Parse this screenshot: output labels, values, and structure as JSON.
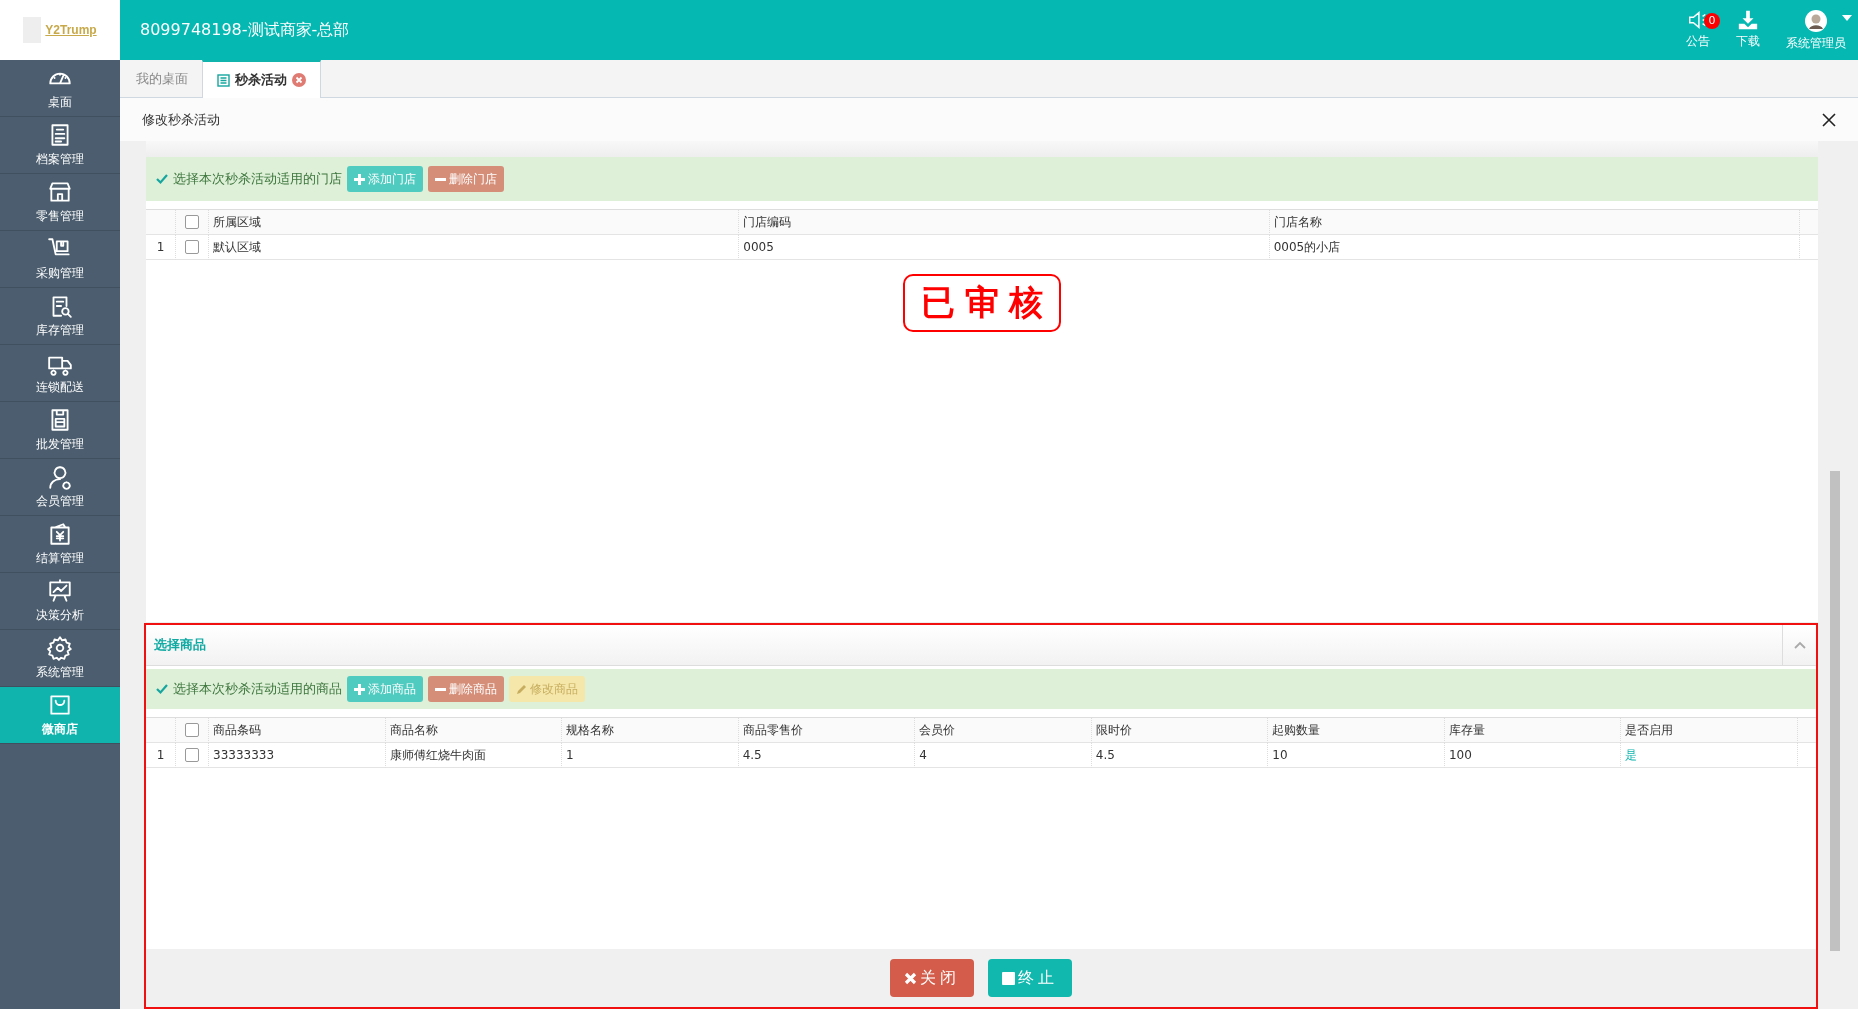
{
  "header": {
    "logo": "Y2Trump",
    "title": "8099748198-测试商家-总部",
    "actions": [
      {
        "label": "公告",
        "badge": "0"
      },
      {
        "label": "下载"
      },
      {
        "label": "系统管理员",
        "dropdown": true
      }
    ]
  },
  "sidebar": {
    "items": [
      {
        "label": "桌面",
        "selected": false
      },
      {
        "label": "档案管理",
        "selected": false
      },
      {
        "label": "零售管理",
        "selected": false
      },
      {
        "label": "采购管理",
        "selected": false
      },
      {
        "label": "库存管理",
        "selected": false
      },
      {
        "label": "连锁配送",
        "selected": false
      },
      {
        "label": "批发管理",
        "selected": false
      },
      {
        "label": "会员管理",
        "selected": false
      },
      {
        "label": "结算管理",
        "selected": false
      },
      {
        "label": "决策分析",
        "selected": false
      },
      {
        "label": "系统管理",
        "selected": false
      },
      {
        "label": "微商店",
        "selected": true
      }
    ]
  },
  "tabs": [
    {
      "label": "我的桌面",
      "selected": false,
      "closable": false
    },
    {
      "label": "秒杀活动",
      "selected": true,
      "closable": true
    }
  ],
  "dialog": {
    "title": "修改秒杀活动"
  },
  "stores": {
    "hint": "选择本次秒杀活动适用的门店",
    "buttons": [
      {
        "label": "添加门店",
        "kind": "add",
        "disabled": false
      },
      {
        "label": "删除门店",
        "kind": "delete",
        "disabled": false
      }
    ],
    "header_checked": false,
    "columns": [
      "所属区域",
      "门店编码",
      "门店名称"
    ],
    "rows": [
      {
        "index": "1",
        "checked": false,
        "cells": [
          "默认区域",
          "0005",
          "0005的小店"
        ]
      }
    ]
  },
  "stamp": "已审核",
  "goods": {
    "title": "选择商品",
    "expanded": true,
    "hint": "选择本次秒杀活动适用的商品",
    "buttons": [
      {
        "label": "添加商品",
        "kind": "add",
        "disabled": false
      },
      {
        "label": "删除商品",
        "kind": "delete",
        "disabled": false
      },
      {
        "label": "修改商品",
        "kind": "edit",
        "disabled": true
      }
    ],
    "header_checked": false,
    "columns": [
      "商品条码",
      "商品名称",
      "规格名称",
      "商品零售价",
      "会员价",
      "限时价",
      "起购数量",
      "库存量",
      "是否启用"
    ],
    "rows": [
      {
        "index": "1",
        "checked": false,
        "cells": [
          {
            "text": "33333333",
            "link": false
          },
          {
            "text": "康师傅红烧牛肉面",
            "link": false
          },
          {
            "text": "1",
            "link": false
          },
          {
            "text": "4.5",
            "link": false
          },
          {
            "text": "4",
            "link": false
          },
          {
            "text": "4.5",
            "link": false
          },
          {
            "text": "10",
            "link": false
          },
          {
            "text": "100",
            "link": false
          },
          {
            "text": "是",
            "link": true
          }
        ]
      }
    ]
  },
  "footer_buttons": [
    {
      "label": "关闭",
      "kind": "close"
    },
    {
      "label": "终止",
      "kind": "stop"
    }
  ]
}
